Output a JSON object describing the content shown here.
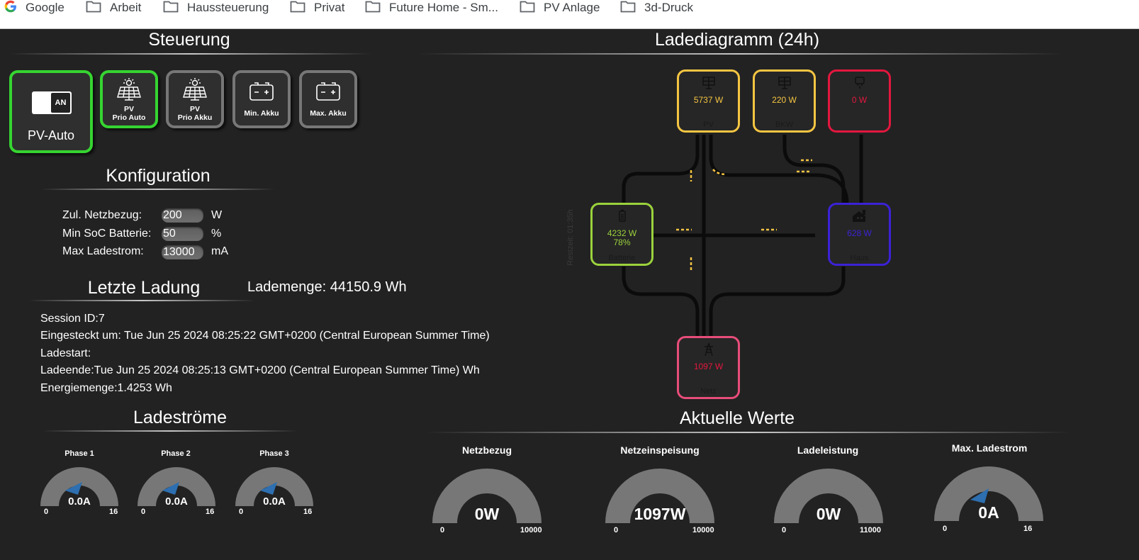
{
  "bookmarks": [
    {
      "label": "Google",
      "icon": "google-icon"
    },
    {
      "label": "Arbeit",
      "icon": "folder-icon"
    },
    {
      "label": "Haussteuerung",
      "icon": "folder-icon"
    },
    {
      "label": "Privat",
      "icon": "folder-icon"
    },
    {
      "label": "Future Home - Sm...",
      "icon": "folder-icon"
    },
    {
      "label": "PV Anlage",
      "icon": "folder-icon"
    },
    {
      "label": "3d-Druck",
      "icon": "folder-icon"
    }
  ],
  "steuerung": {
    "title": "Steuerung",
    "switch_label": "AN",
    "pv_auto_label": "PV-Auto",
    "buttons": [
      {
        "line1": "PV",
        "line2": "Prio Auto",
        "icon": "solar-panel-icon",
        "active": true
      },
      {
        "line1": "PV",
        "line2": "Prio Akku",
        "icon": "solar-panel-icon",
        "active": false
      },
      {
        "line1": "Min. Akku",
        "line2": "",
        "icon": "battery-icon",
        "active": false
      },
      {
        "line1": "Max. Akku",
        "line2": "",
        "icon": "battery-icon",
        "active": false
      }
    ]
  },
  "konfiguration": {
    "title": "Konfiguration",
    "rows": [
      {
        "label": "Zul. Netzbezug:",
        "value": "200",
        "unit": "W"
      },
      {
        "label": "Min SoC Batterie:",
        "value": "50",
        "unit": "%"
      },
      {
        "label": "Max Ladestrom:",
        "value": "13000",
        "unit": "mA"
      }
    ]
  },
  "lademenge": "Lademenge: 44150.9 Wh",
  "letzte_ladung": {
    "title": "Letzte Ladung",
    "lines": [
      "Session ID:7",
      "Eingesteckt um: Tue Jun 25 2024 08:25:22 GMT+0200 (Central European Summer Time)",
      "Ladestart:",
      "Ladeende:Tue Jun 25 2024 08:25:13 GMT+0200 (Central European Summer Time) Wh",
      "Energiemenge:1.4253 Wh"
    ]
  },
  "ladediagramm": {
    "title": "Ladediagramm (24h)",
    "restzeit": "Restzeit: 01:35h",
    "nodes": {
      "pv": {
        "value": "5737 W",
        "name": "PV",
        "color": "#f5c542"
      },
      "bkw": {
        "value": "220 W",
        "name": "BKW",
        "color": "#f5c542"
      },
      "auto": {
        "value": "0 W",
        "name": "",
        "color": "#e3173e"
      },
      "batterie": {
        "value": "4232 W",
        "soc": "78%",
        "name": "Batterie",
        "color": "#9bd23c"
      },
      "haus": {
        "value": "628 W",
        "name": "Haus",
        "color": "#3b22d6"
      },
      "netz": {
        "value": "1097 W",
        "name": "Netz",
        "color": "#e84d7a",
        "value_color": "#e3173e"
      }
    }
  },
  "ladestroeme": {
    "title": "Ladeströme",
    "gauges": [
      {
        "title": "Phase 1",
        "value": "0.0A",
        "min": "0",
        "max": "16",
        "level": 0
      },
      {
        "title": "Phase 2",
        "value": "0.0A",
        "min": "0",
        "max": "16",
        "level": 0
      },
      {
        "title": "Phase 3",
        "value": "0.0A",
        "min": "0",
        "max": "16",
        "level": 0
      }
    ]
  },
  "aktuelle_werte": {
    "title": "Aktuelle Werte",
    "gauges": [
      {
        "title": "Netzbezug",
        "value": "0W",
        "min": "0",
        "max": "10000",
        "level": 0
      },
      {
        "title": "Netzeinspeisung",
        "value": "1097W",
        "min": "0",
        "max": "10000",
        "level": 0.1097
      },
      {
        "title": "Ladeleistung",
        "value": "0W",
        "min": "0",
        "max": "11000",
        "level": 0
      },
      {
        "title": "Max. Ladestrom",
        "value": "0A",
        "min": "0",
        "max": "16",
        "level": 0
      }
    ]
  },
  "colors": {
    "background": "#222222",
    "active_border": "#36d431",
    "inactive_border": "#777777",
    "gauge_track": "#777777",
    "gauge_pointer": "#2d6fb0",
    "flow_line": "#0b0b0b",
    "flow_dash": "#f5c542"
  }
}
